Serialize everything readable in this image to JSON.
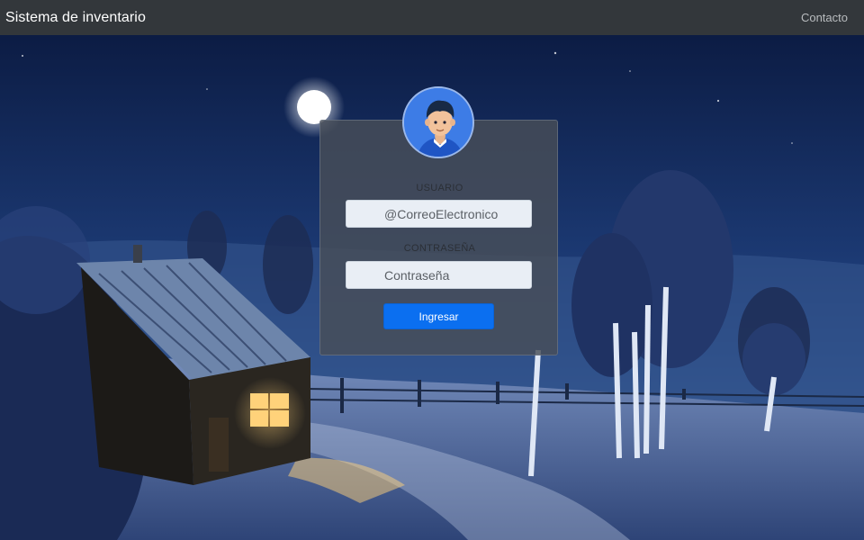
{
  "navbar": {
    "brand": "Sistema de inventario",
    "contact_link": "Contacto"
  },
  "login": {
    "user_label": "USUARIO",
    "user_placeholder": "@CorreoElectronico",
    "password_label": "CONTRASEÑA",
    "password_placeholder": "Contraseña",
    "submit_label": "Ingresar"
  },
  "icons": {
    "avatar": "user-avatar-icon"
  },
  "colors": {
    "navbar_bg": "#33373b",
    "primary_button": "#0b6ff0",
    "avatar_bg": "#3d7ce6"
  }
}
